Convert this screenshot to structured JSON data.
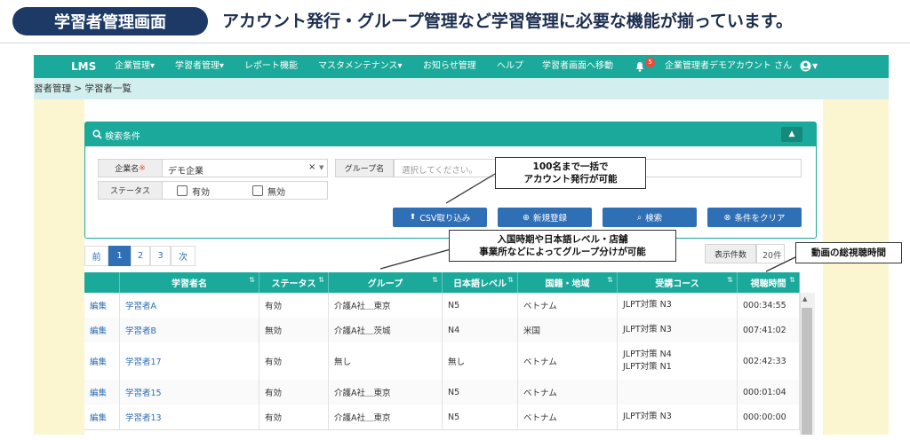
{
  "page": {
    "badge_title": "学習者管理画面",
    "caption": "アカウント発行・グループ管理など学習管理に必要な機能が揃っています。"
  },
  "navbar": {
    "brand": "LMS",
    "items": [
      "企業管理▾",
      "学習者管理▾",
      "レポート機能",
      "マスタメンテナンス▾",
      "お知らせ管理",
      "ヘルプ",
      "学習者画面へ移動"
    ],
    "notification_count": "5",
    "user": "企業管理者デモアカウント さん"
  },
  "breadcrumb": "習者管理 > 学習者一覧",
  "search": {
    "title": "検索条件",
    "company_label": "企業名",
    "required_mark": "※",
    "company_value": "デモ企業",
    "clear_mark": "×",
    "group_label": "グループ名",
    "group_placeholder": "選択してください。",
    "status_label": "ステータス",
    "status_options": [
      "有効",
      "無効"
    ],
    "buttons": {
      "csv": "CSV取り込み",
      "new": "新規登録",
      "search": "検索",
      "clear": "条件をクリア"
    }
  },
  "pagination": {
    "prev": "前",
    "pages": [
      "1",
      "2",
      "3"
    ],
    "next": "次",
    "active": "1"
  },
  "count": {
    "label": "表示件数",
    "value": "20件"
  },
  "table": {
    "headers": [
      "学習者名",
      "ステータス",
      "グループ",
      "日本語レベル",
      "国籍・地域",
      "受講コース",
      "視聴時間"
    ],
    "edit_label": "編集",
    "rows": [
      {
        "name": "学習者A",
        "status": "有効",
        "group": "介護A社＿東京",
        "level": "N5",
        "country": "ベトナム",
        "course": [
          "JLPT対策 N3"
        ],
        "time": "000:34:55"
      },
      {
        "name": "学習者B",
        "status": "無効",
        "group": "介護A社＿茨城",
        "level": "N4",
        "country": "米国",
        "course": [
          "JLPT対策 N3"
        ],
        "time": "007:41:02"
      },
      {
        "name": "学習者17",
        "status": "有効",
        "group": "無し",
        "level": "無し",
        "country": "ベトナム",
        "course": [
          "JLPT対策 N4",
          "JLPT対策 N1"
        ],
        "time": "002:42:33"
      },
      {
        "name": "学習者15",
        "status": "有効",
        "group": "介護A社＿東京",
        "level": "N5",
        "country": "ベトナム",
        "course": [],
        "time": "000:01:04"
      },
      {
        "name": "学習者13",
        "status": "有効",
        "group": "介護A社＿東京",
        "level": "N5",
        "country": "ベトナム",
        "course": [
          "JLPT対策 N3"
        ],
        "time": "000:00:00"
      }
    ]
  },
  "callouts": {
    "account": [
      "100名まで一括で",
      "アカウント発行が可能"
    ],
    "group": [
      "入国時期や日本語レベル・店舗",
      "事業所などによってグループ分けが可能"
    ],
    "time": "動画の総視聴時間"
  },
  "colors": {
    "navbar": "#1aa99a",
    "badge": "#1d3a66",
    "button": "#2f6fb5",
    "side": "#fbf6d0"
  }
}
